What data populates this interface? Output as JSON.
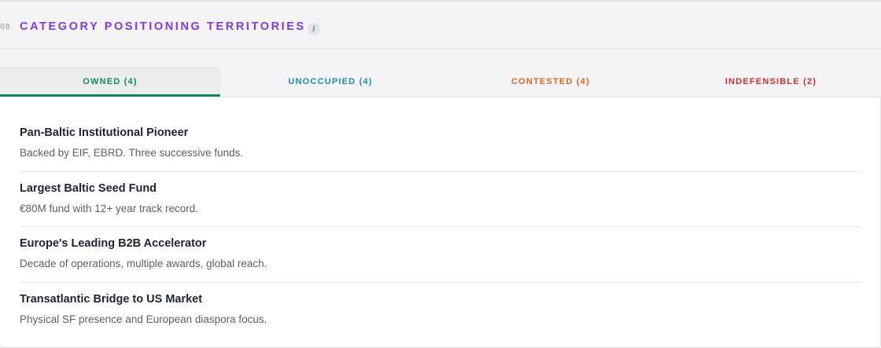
{
  "section": {
    "number": "08",
    "title": "CATEGORY POSITIONING TERRITORIES",
    "info_icon": "info-icon"
  },
  "tabs": [
    {
      "label": "OWNED (4)",
      "color": "#0f8a5f",
      "active": true
    },
    {
      "label": "UNOCCUPIED (4)",
      "color": "#1a8fb0",
      "active": false
    },
    {
      "label": "CONTESTED (4)",
      "color": "#e0661c",
      "active": false
    },
    {
      "label": "INDEFENSIBLE (2)",
      "color": "#d62d2d",
      "active": false
    }
  ],
  "items": [
    {
      "title": "Pan-Baltic Institutional Pioneer",
      "desc": "Backed by EIF, EBRD. Three successive funds."
    },
    {
      "title": "Largest Baltic Seed Fund",
      "desc": "€80M fund with 12+ year track record."
    },
    {
      "title": "Europe's Leading B2B Accelerator",
      "desc": "Decade of operations, multiple awards, global reach."
    },
    {
      "title": "Transatlantic Bridge to US Market",
      "desc": "Physical SF presence and European diaspora focus."
    }
  ]
}
